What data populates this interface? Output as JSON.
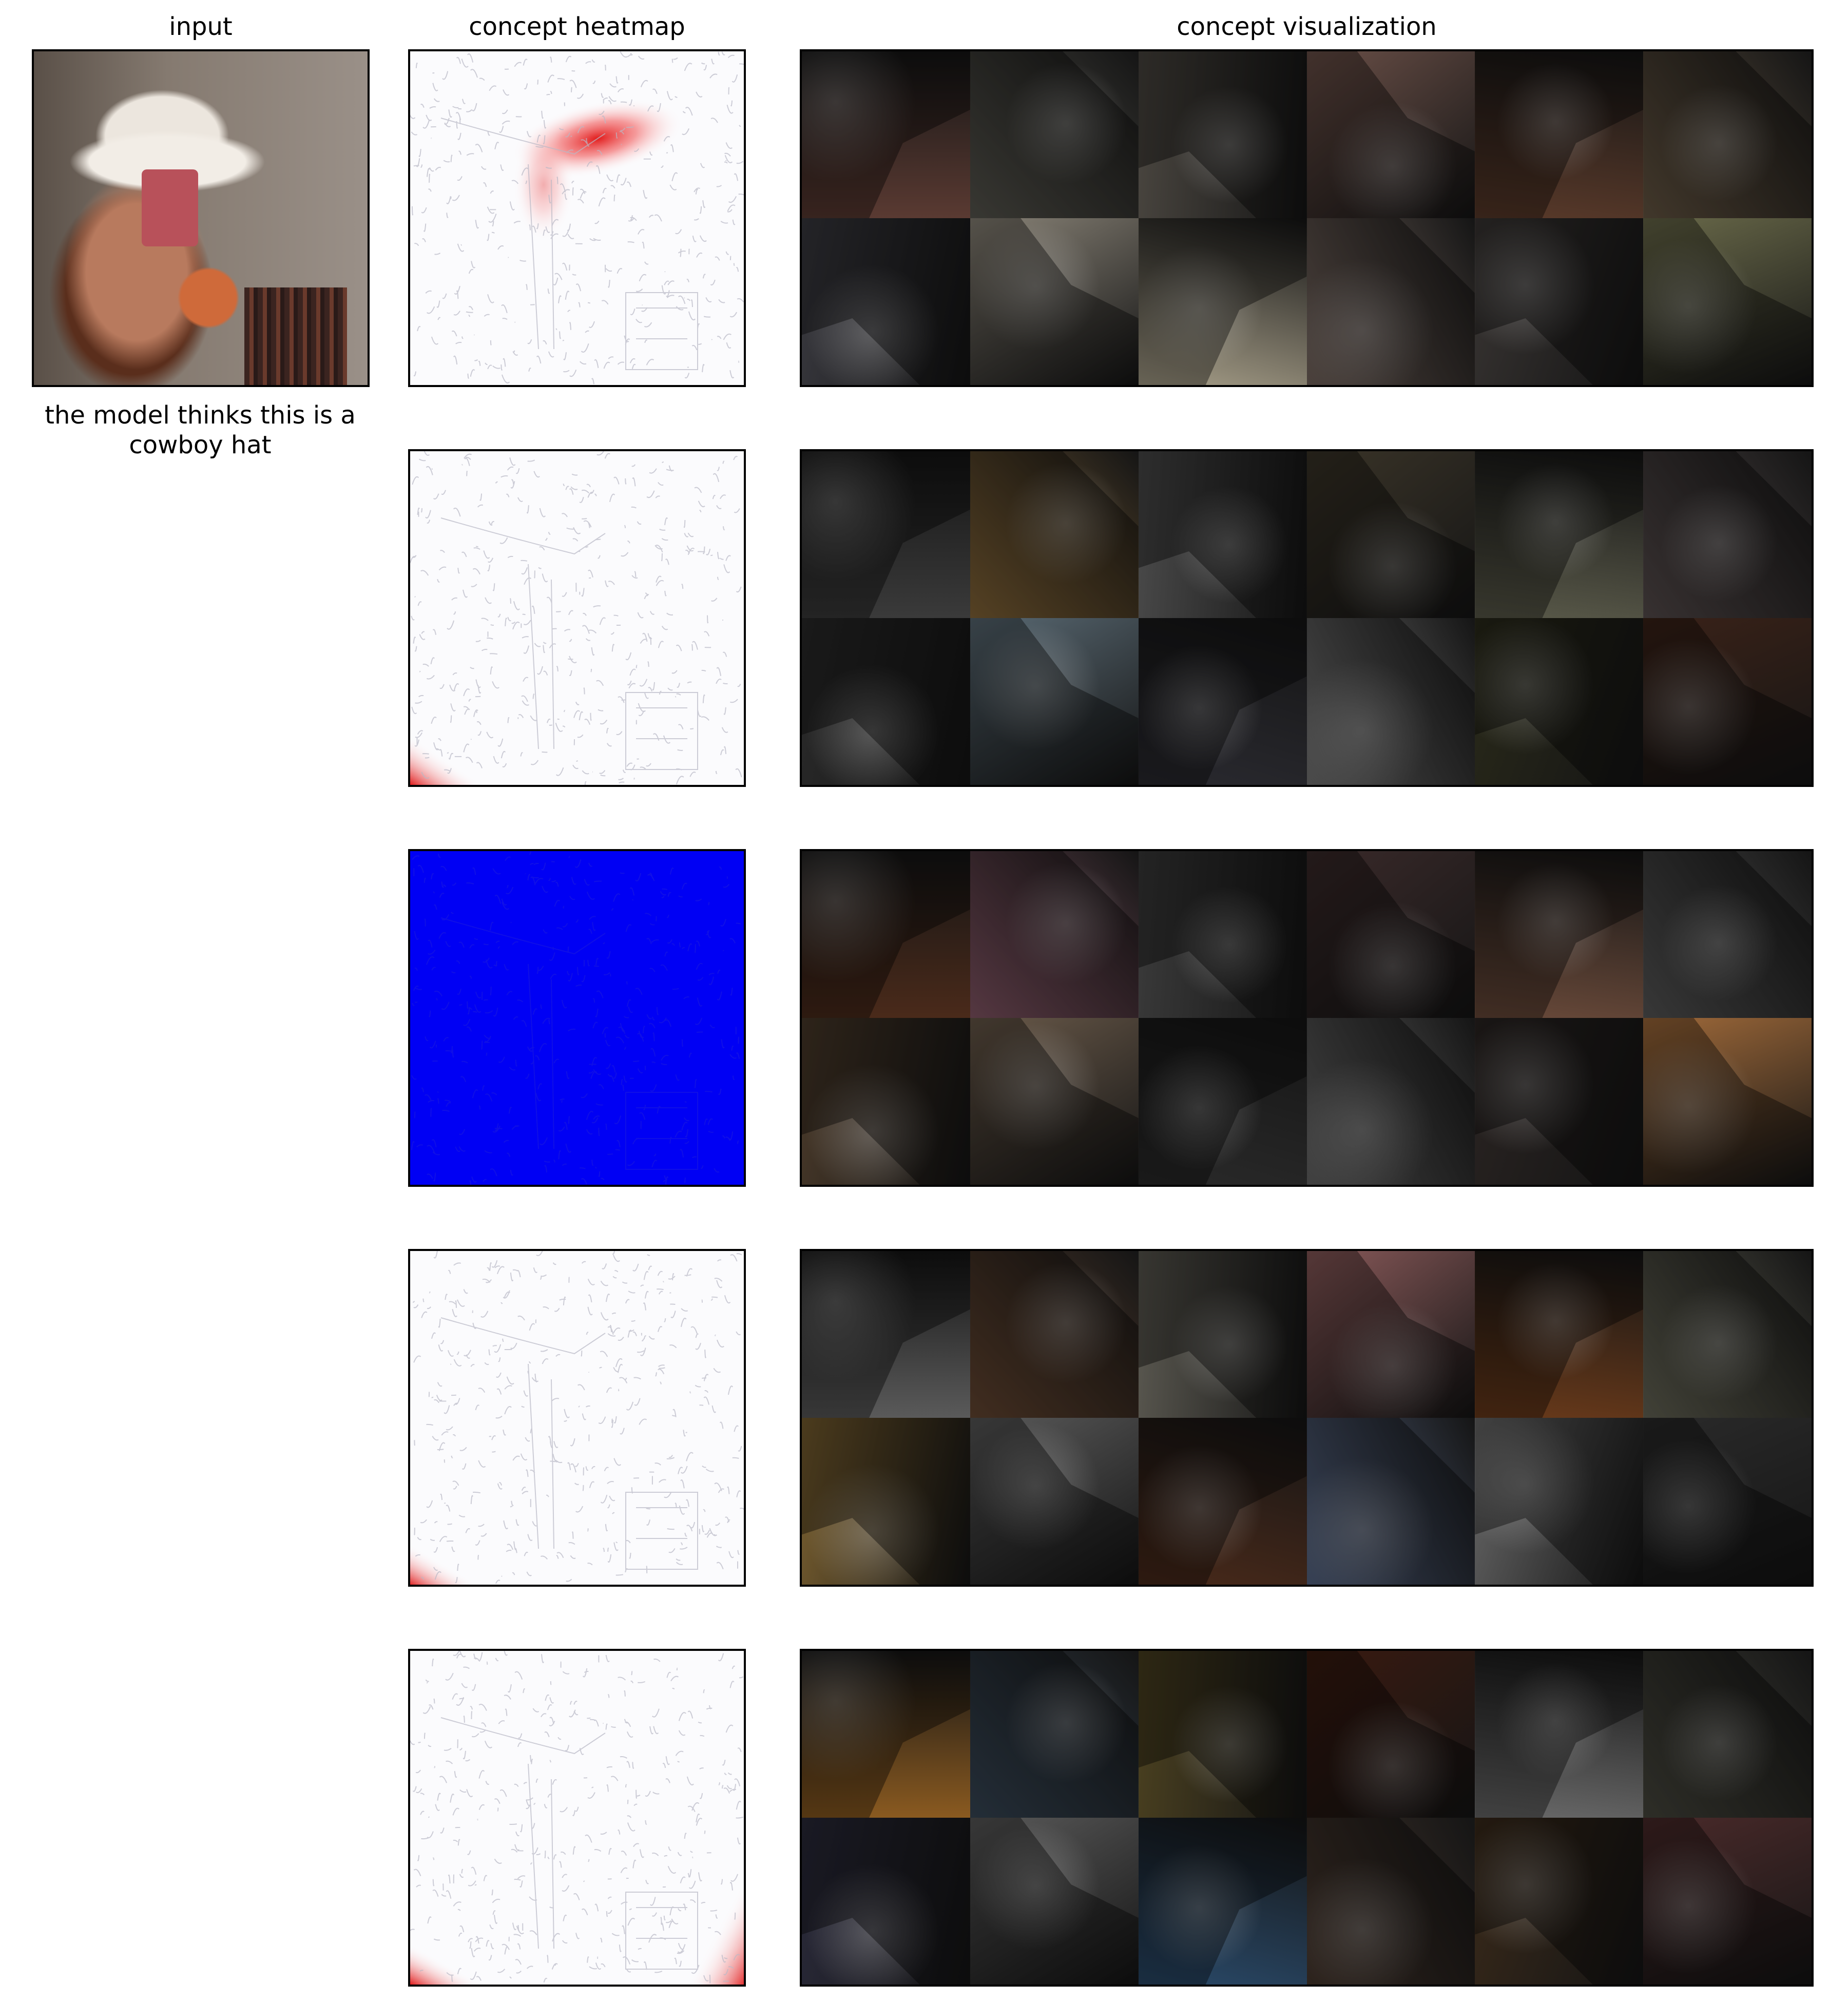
{
  "columns": {
    "input": "input",
    "heatmap": "concept heatmap",
    "visualization": "concept visualization"
  },
  "prediction_caption": "the model thinks this is a cowboy hat",
  "rows": [
    {
      "heatmap": "hat-region",
      "tiles": [
        "#5a3a32",
        "#5b5a52",
        "#4a4640",
        "#6b5048",
        "#5a3a2a",
        "#6a5a46",
        "#3a3a40",
        "#8a8478",
        "#a8a08a",
        "#7a6a62",
        "#3a3634",
        "#6a6a4a"
      ]
    },
    {
      "heatmap": "corner",
      "tiles": [
        "#3a3a3a",
        "#8a6a3a",
        "#4a4a4a",
        "#3a3428",
        "#5a5a4a",
        "#5a5050",
        "#2a2a2a",
        "#5a6a74",
        "#2a2a30",
        "#7a7a7a",
        "#2a2a1a",
        "#3a2218"
      ]
    },
    {
      "heatmap": "full-blue",
      "tiles": [
        "#4a2a1a",
        "#8a5a6a",
        "#3a3a3a",
        "#3a2a2a",
        "#6a4a3a",
        "#5a5a5a",
        "#4a3a2a",
        "#6a5a4a",
        "#2a2a2a",
        "#6a6a6a",
        "#2a2422",
        "#a06a3a"
      ]
    },
    {
      "heatmap": "corner-faint",
      "tiles": [
        "#5a5a5a",
        "#6a4a34",
        "#5a5850",
        "#8a5a5a",
        "#6a3a1a",
        "#6a6a5a",
        "#7a6030",
        "#5a5a5a",
        "#4a2a1a",
        "#5a6a8a",
        "#6a6a6a",
        "#2a2a2a"
      ]
    },
    {
      "heatmap": "corner-both",
      "tiles": [
        "#8a5a20",
        "#3a4a5a",
        "#4a4020",
        "#3a1a10",
        "#6a6a6a",
        "#4a4a40",
        "#2a2a3a",
        "#5a5a5a",
        "#2a4a6a",
        "#4a3a30",
        "#3a2a1a",
        "#4a2a2a"
      ]
    }
  ]
}
